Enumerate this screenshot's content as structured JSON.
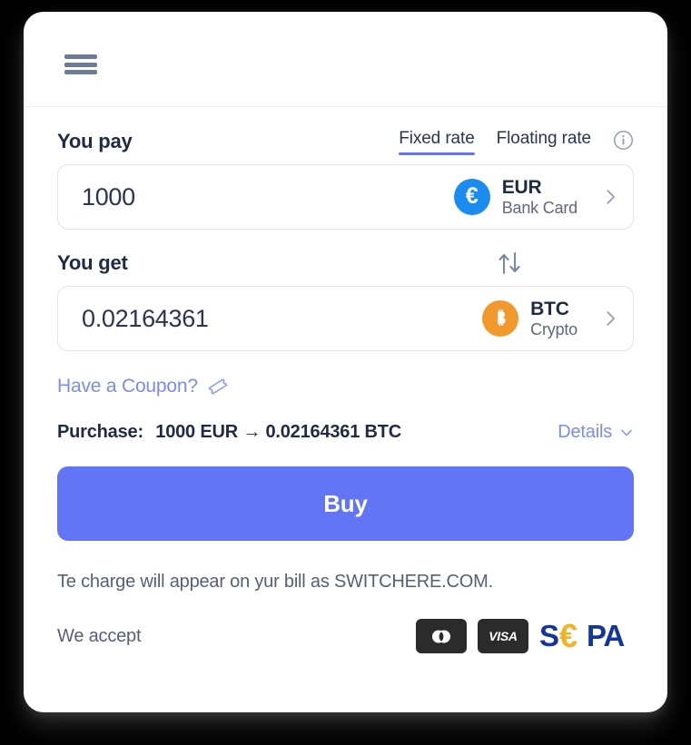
{
  "header": {
    "menu_icon": "hamburger-menu-icon"
  },
  "exchange": {
    "pay_label": "You pay",
    "get_label": "You get",
    "tabs": [
      {
        "label": "Fixed rate",
        "active": true
      },
      {
        "label": "Floating rate",
        "active": false
      }
    ],
    "info_icon": "info-circle-icon",
    "swap_icon": "swap-arrows-icon",
    "pay": {
      "amount": "1000",
      "placeholder": "0",
      "currency_code": "EUR",
      "currency_sub": "Bank Card",
      "coin_symbol": "€",
      "coin_color": "#1a8cf0",
      "chevron_icon": "chevron-right-icon"
    },
    "get": {
      "amount": "0.02164361",
      "placeholder": "0",
      "currency_code": "BTC",
      "currency_sub": "Crypto",
      "coin_symbol": "Ƀ",
      "coin_color": "#f2992e",
      "chevron_icon": "chevron-right-icon"
    }
  },
  "coupon": {
    "label": "Have a Coupon?",
    "icon": "ticket-icon"
  },
  "summary": {
    "prefix": "Purchase:",
    "value": "1000 EUR → 0.02164361 BTC",
    "details_label": "Details",
    "details_icon": "chevron-down-icon"
  },
  "actions": {
    "buy_label": "Buy",
    "buy_color": "#6275f4"
  },
  "footer": {
    "disclaimer": "Te charge will appear on yur bill as SWITCHERE.COM.",
    "accept_label": "We accept",
    "logos": [
      {
        "name": "mastercard-logo",
        "text": ""
      },
      {
        "name": "visa-logo",
        "text": "VISA"
      },
      {
        "name": "sepa-logo",
        "text": "SEPA"
      }
    ]
  }
}
